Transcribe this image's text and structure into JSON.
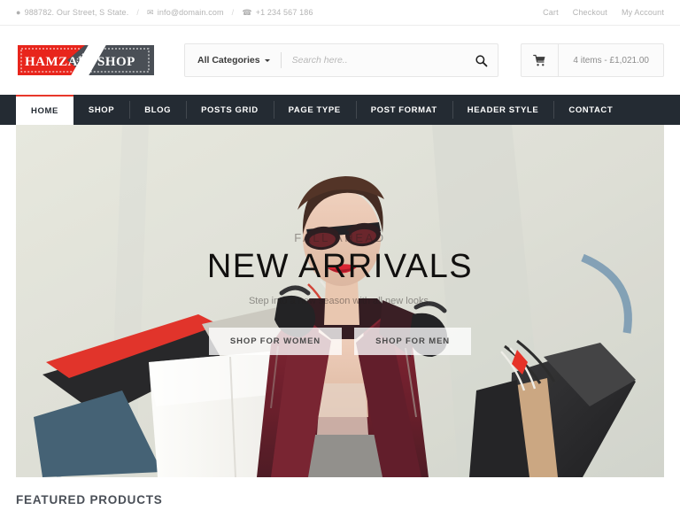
{
  "topbar": {
    "address": "988782. Our Street, S State.",
    "email": "info@domain.com",
    "phone": "+1 234 567 186",
    "sep": "/",
    "links": [
      {
        "label": "Cart"
      },
      {
        "label": "Checkout"
      },
      {
        "label": "My Account"
      }
    ]
  },
  "header": {
    "logo": {
      "left_text": "HAMZAH",
      "right_text": "SHOP"
    },
    "search": {
      "category_label": "All Categories",
      "placeholder": "Search here..",
      "value": ""
    },
    "cart": {
      "summary": "4 items - £1,021.00"
    }
  },
  "nav": {
    "items": [
      {
        "label": "HOME",
        "active": true
      },
      {
        "label": "SHOP",
        "active": false
      },
      {
        "label": "BLOG",
        "active": false
      },
      {
        "label": "POSTS GRID",
        "active": false
      },
      {
        "label": "PAGE TYPE",
        "active": false
      },
      {
        "label": "POST FORMAT",
        "active": false
      },
      {
        "label": "HEADER STYLE",
        "active": false
      },
      {
        "label": "CONTACT",
        "active": false
      }
    ]
  },
  "hero": {
    "kicker": "FALL AHEAD",
    "title": "NEW ARRIVALS",
    "subtitle": "Step into a new season with all new looks.",
    "button_women": "SHOP FOR WOMEN",
    "button_men": "SHOP FOR MEN"
  },
  "featured": {
    "title": "FEATURED PRODUCTS"
  },
  "colors": {
    "nav_bg": "#242b33",
    "accent_red": "#e8372b",
    "logo_dark": "#4a4f56",
    "hero_bg": "#dfe0d8",
    "coat_red": "#6e1622",
    "muted_text": "#b4b4b4"
  }
}
